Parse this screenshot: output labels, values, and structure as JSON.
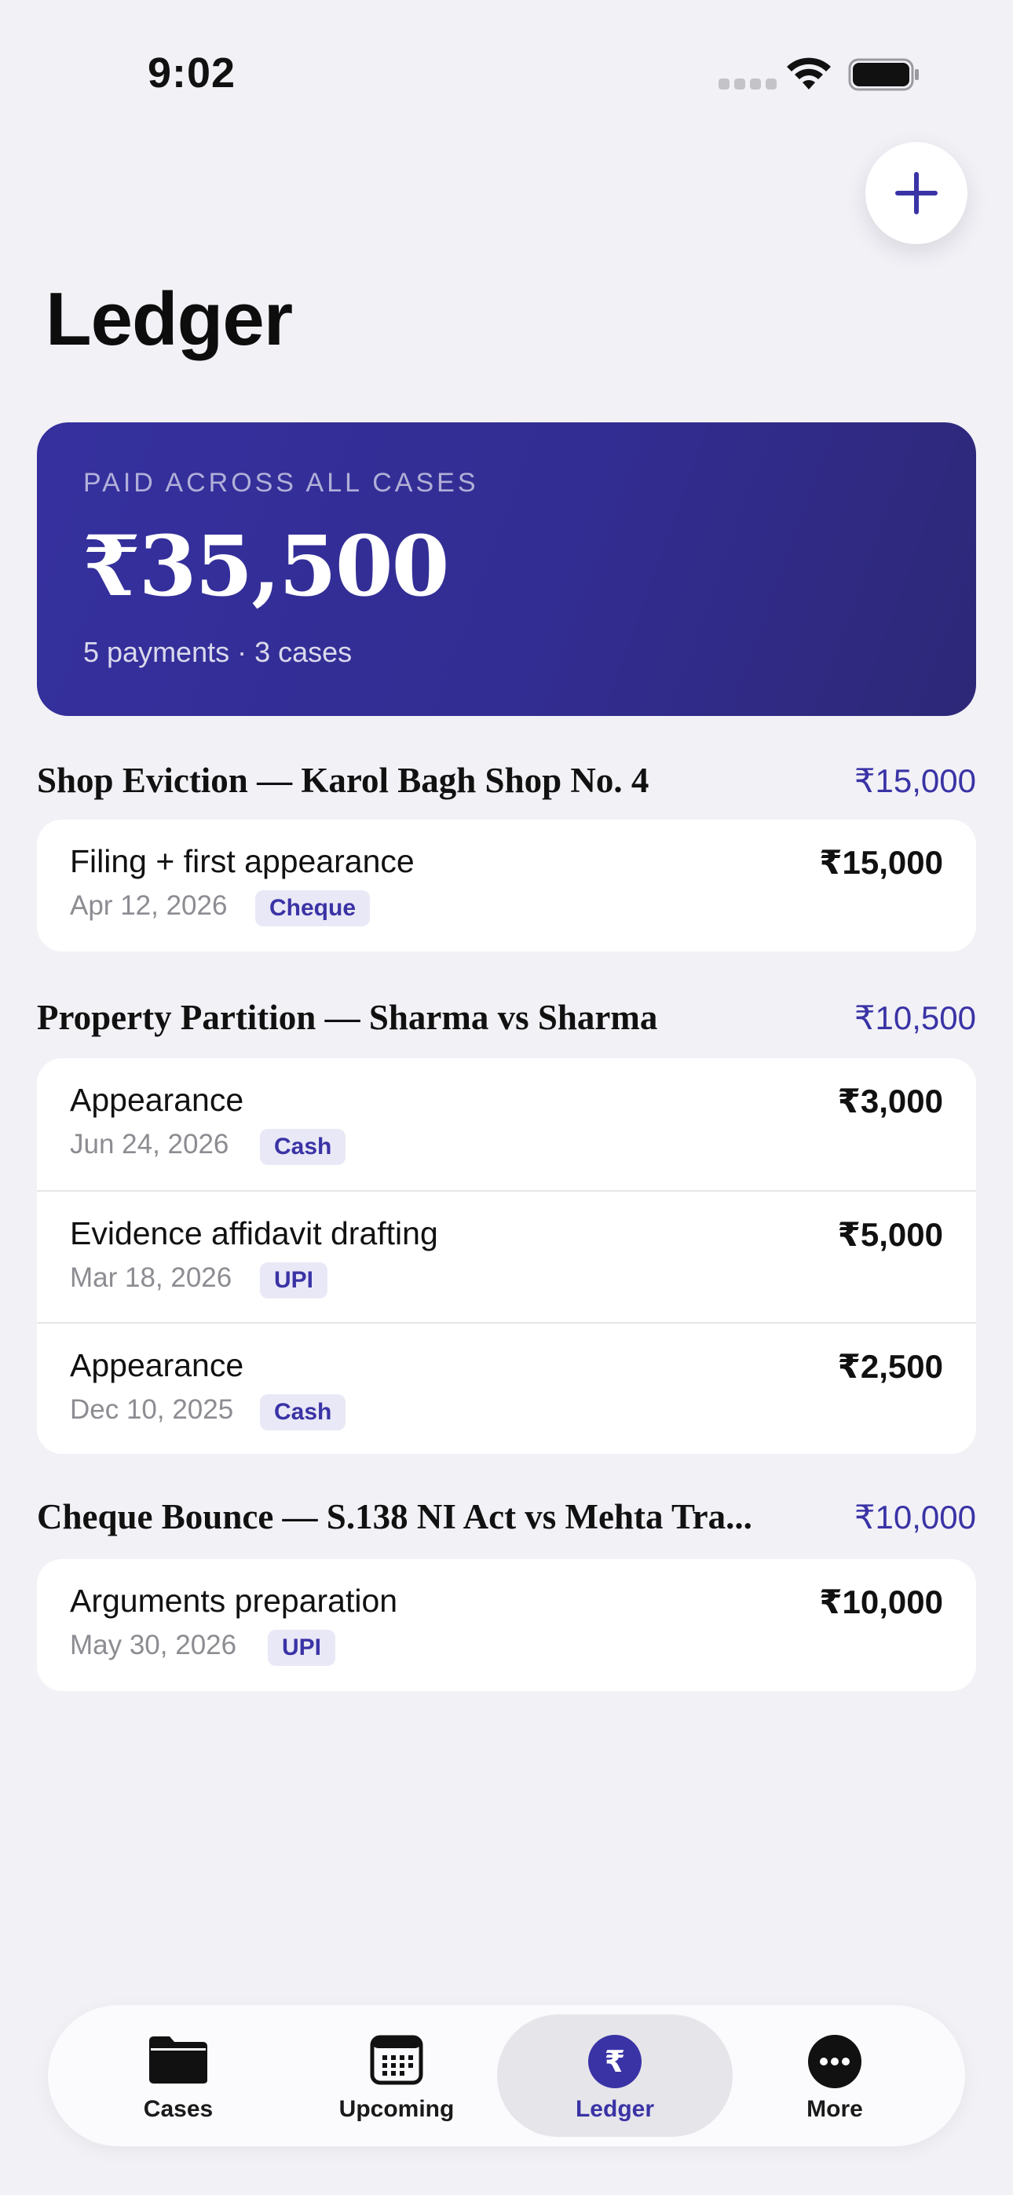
{
  "status_bar": {
    "time": "9:02"
  },
  "header": {
    "title": "Ledger"
  },
  "summary": {
    "label": "PAID ACROSS ALL CASES",
    "amount": "₹35,500",
    "meta": "5 payments · 3 cases"
  },
  "cases": [
    {
      "title": "Shop Eviction — Karol Bagh Shop No. 4",
      "total": "₹15,000",
      "payments": [
        {
          "description": "Filing + first appearance",
          "date": "Apr 12, 2026",
          "method": "Cheque",
          "amount": "₹15,000"
        }
      ]
    },
    {
      "title": "Property Partition — Sharma vs Sharma",
      "total": "₹10,500",
      "payments": [
        {
          "description": "Appearance",
          "date": "Jun 24, 2026",
          "method": "Cash",
          "amount": "₹3,000"
        },
        {
          "description": "Evidence affidavit drafting",
          "date": "Mar 18, 2026",
          "method": "UPI",
          "amount": "₹5,000"
        },
        {
          "description": "Appearance",
          "date": "Dec 10, 2025",
          "method": "Cash",
          "amount": "₹2,500"
        }
      ]
    },
    {
      "title": "Cheque Bounce — S.138 NI Act vs Mehta Tra...",
      "total": "₹10,000",
      "payments": [
        {
          "description": "Arguments preparation",
          "date": "May 30, 2026",
          "method": "UPI",
          "amount": "₹10,000"
        }
      ]
    }
  ],
  "tabs": [
    {
      "label": "Cases",
      "icon": "folder-icon"
    },
    {
      "label": "Upcoming",
      "icon": "calendar-icon"
    },
    {
      "label": "Ledger",
      "icon": "rupee-icon",
      "active": true
    },
    {
      "label": "More",
      "icon": "more-icon"
    }
  ],
  "colors": {
    "accent": "#3a33a6",
    "background": "#f2f1f6",
    "card": "#ffffff"
  }
}
